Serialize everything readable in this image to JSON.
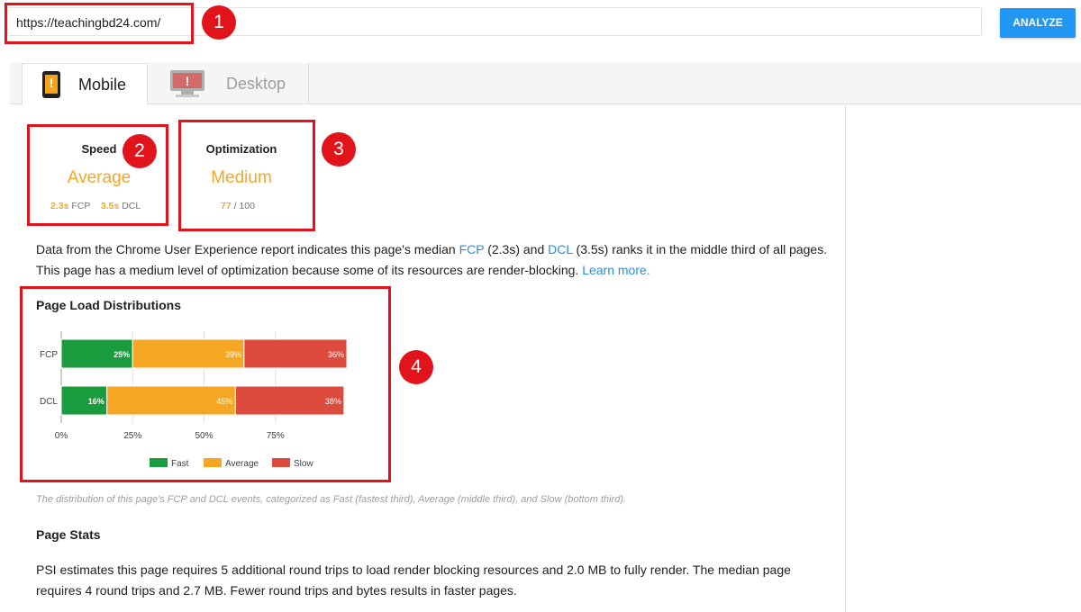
{
  "url_bar": {
    "value": "https://teachingbd24.com/"
  },
  "analyze_button": {
    "label": "ANALYZE"
  },
  "tabs": [
    {
      "label": "Mobile",
      "icon": "mobile-phone-icon",
      "active": true
    },
    {
      "label": "Desktop",
      "icon": "desktop-monitor-icon",
      "active": false
    }
  ],
  "annotations": [
    "1",
    "2",
    "3",
    "4"
  ],
  "speed": {
    "title": "Speed",
    "rating": "Average",
    "fcp_value": "2.3s",
    "fcp_label": "FCP",
    "dcl_value": "3.5s",
    "dcl_label": "DCL"
  },
  "optimization": {
    "title": "Optimization",
    "rating": "Medium",
    "score": "77",
    "score_max": "/ 100"
  },
  "summary": {
    "text_1": "Data from the Chrome User Experience report indicates this page's median ",
    "fcp_link": "FCP",
    "text_2": " (2.3s) and ",
    "dcl_link": "DCL",
    "text_3": " (3.5s) ranks it in the middle third of all pages. This page has a medium level of optimization because some of its resources are render-blocking. ",
    "learn_more": "Learn more."
  },
  "distributions": {
    "title": "Page Load Distributions",
    "caption": "The distribution of this page's FCP and DCL events, categorized as Fast (fastest third), Average (middle third), and Slow (bottom third)."
  },
  "chart_data": {
    "type": "bar",
    "orientation": "horizontal",
    "stacked": true,
    "categories": [
      "FCP",
      "DCL"
    ],
    "series": [
      {
        "name": "Fast",
        "values": [
          25,
          16
        ],
        "labels": [
          "25%",
          "16%"
        ],
        "color": "#1a9c3e"
      },
      {
        "name": "Average",
        "values": [
          39,
          45
        ],
        "labels": [
          "39%",
          "45%"
        ],
        "color": "#f5a623"
      },
      {
        "name": "Slow",
        "values": [
          36,
          38
        ],
        "labels": [
          "36%",
          "38%"
        ],
        "color": "#dc4b3c"
      }
    ],
    "x_ticks": [
      "0%",
      "25%",
      "50%",
      "75%"
    ],
    "legend": "bottom"
  },
  "page_stats": {
    "title": "Page Stats",
    "text": "PSI estimates this page requires 5 additional round trips to load render blocking resources and 2.0 MB to fully render. The median page requires 4 round trips and 2.7 MB. Fewer round trips and bytes results in faster pages."
  },
  "colors": {
    "accent": "#2196f3",
    "annotation_red": "#e1141c",
    "average_orange": "#f5a623",
    "link_blue": "#2a8fd6"
  }
}
